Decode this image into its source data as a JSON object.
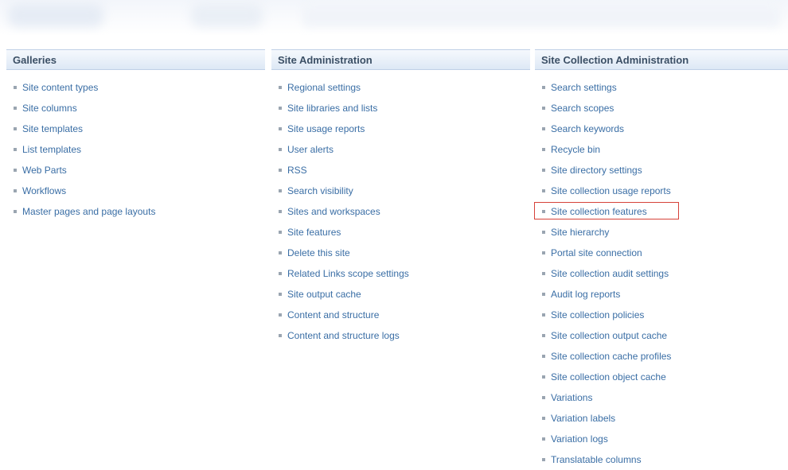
{
  "galleries": {
    "title": "Galleries",
    "items": [
      {
        "label": "Site content types"
      },
      {
        "label": "Site columns"
      },
      {
        "label": "Site templates"
      },
      {
        "label": "List templates"
      },
      {
        "label": "Web Parts"
      },
      {
        "label": "Workflows"
      },
      {
        "label": "Master pages and page layouts"
      }
    ]
  },
  "site_administration": {
    "title": "Site Administration",
    "items": [
      {
        "label": "Regional settings"
      },
      {
        "label": "Site libraries and lists"
      },
      {
        "label": "Site usage reports"
      },
      {
        "label": "User alerts"
      },
      {
        "label": "RSS"
      },
      {
        "label": "Search visibility"
      },
      {
        "label": "Sites and workspaces"
      },
      {
        "label": "Site features"
      },
      {
        "label": "Delete this site"
      },
      {
        "label": "Related Links scope settings"
      },
      {
        "label": "Site output cache"
      },
      {
        "label": "Content and structure"
      },
      {
        "label": "Content and structure logs"
      }
    ]
  },
  "site_collection_administration": {
    "title": "Site Collection Administration",
    "highlighted_item": "Site collection features",
    "highlight_color": "#d6423a",
    "items": [
      {
        "label": "Search settings"
      },
      {
        "label": "Search scopes"
      },
      {
        "label": "Search keywords"
      },
      {
        "label": "Recycle bin"
      },
      {
        "label": "Site directory settings"
      },
      {
        "label": "Site collection usage reports"
      },
      {
        "label": "Site collection features"
      },
      {
        "label": "Site hierarchy"
      },
      {
        "label": "Portal site connection"
      },
      {
        "label": "Site collection audit settings"
      },
      {
        "label": "Audit log reports"
      },
      {
        "label": "Site collection policies"
      },
      {
        "label": "Site collection output cache"
      },
      {
        "label": "Site collection cache profiles"
      },
      {
        "label": "Site collection object cache"
      },
      {
        "label": "Variations"
      },
      {
        "label": "Variation labels"
      },
      {
        "label": "Variation logs"
      },
      {
        "label": "Translatable columns"
      }
    ]
  },
  "colors": {
    "link": "#3a6ea5",
    "header_text": "#3b4f65",
    "bullet": "#9aa5b1"
  }
}
